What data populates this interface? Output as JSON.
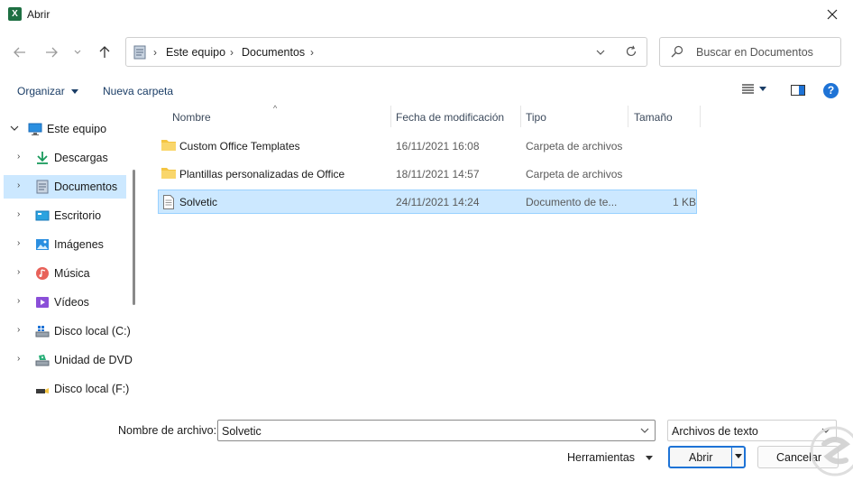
{
  "window": {
    "title": "Abrir",
    "app_icon_letter": "X"
  },
  "address": {
    "crumbs": [
      "Este equipo",
      "Documentos"
    ]
  },
  "search": {
    "placeholder": "Buscar en Documentos"
  },
  "commandbar": {
    "organize_label": "Organizar",
    "new_folder_label": "Nueva carpeta"
  },
  "help": {
    "label": "?"
  },
  "sidebar": {
    "items": [
      {
        "label": "Este equipo",
        "icon": "computer-icon",
        "expanded": true
      },
      {
        "label": "Descargas",
        "icon": "downloads-icon"
      },
      {
        "label": "Documentos",
        "icon": "documents-icon",
        "selected": true
      },
      {
        "label": "Escritorio",
        "icon": "desktop-icon"
      },
      {
        "label": "Imágenes",
        "icon": "pictures-icon"
      },
      {
        "label": "Música",
        "icon": "music-icon"
      },
      {
        "label": "Vídeos",
        "icon": "videos-icon"
      },
      {
        "label": "Disco local (C:)",
        "icon": "drive-icon"
      },
      {
        "label": "Unidad de DVD",
        "icon": "dvd-icon"
      },
      {
        "label": "Disco local (F:)",
        "icon": "usb-drive-icon"
      }
    ]
  },
  "list": {
    "columns": [
      "Nombre",
      "Fecha de modificación",
      "Tipo",
      "Tamaño"
    ],
    "rows": [
      {
        "name": "Custom Office Templates",
        "date": "16/11/2021 16:08",
        "type": "Carpeta de archivos",
        "size": "",
        "icon": "folder-icon"
      },
      {
        "name": "Plantillas personalizadas de Office",
        "date": "18/11/2021 14:57",
        "type": "Carpeta de archivos",
        "size": "",
        "icon": "folder-icon"
      },
      {
        "name": "Solvetic",
        "date": "24/11/2021 14:24",
        "type": "Documento de te...",
        "size": "1 KB",
        "icon": "text-file-icon",
        "selected": true
      }
    ]
  },
  "bottom": {
    "filename_label": "Nombre de archivo:",
    "filename_value": "Solvetic",
    "filter_value": "Archivos de texto",
    "tools_label": "Herramientas",
    "open_label": "Abrir",
    "cancel_label": "Cancelar"
  },
  "colors": {
    "accent": "#1e73d6",
    "selection": "#cce8ff",
    "excel_green": "#1d6f42",
    "folder": "#f4c542"
  }
}
